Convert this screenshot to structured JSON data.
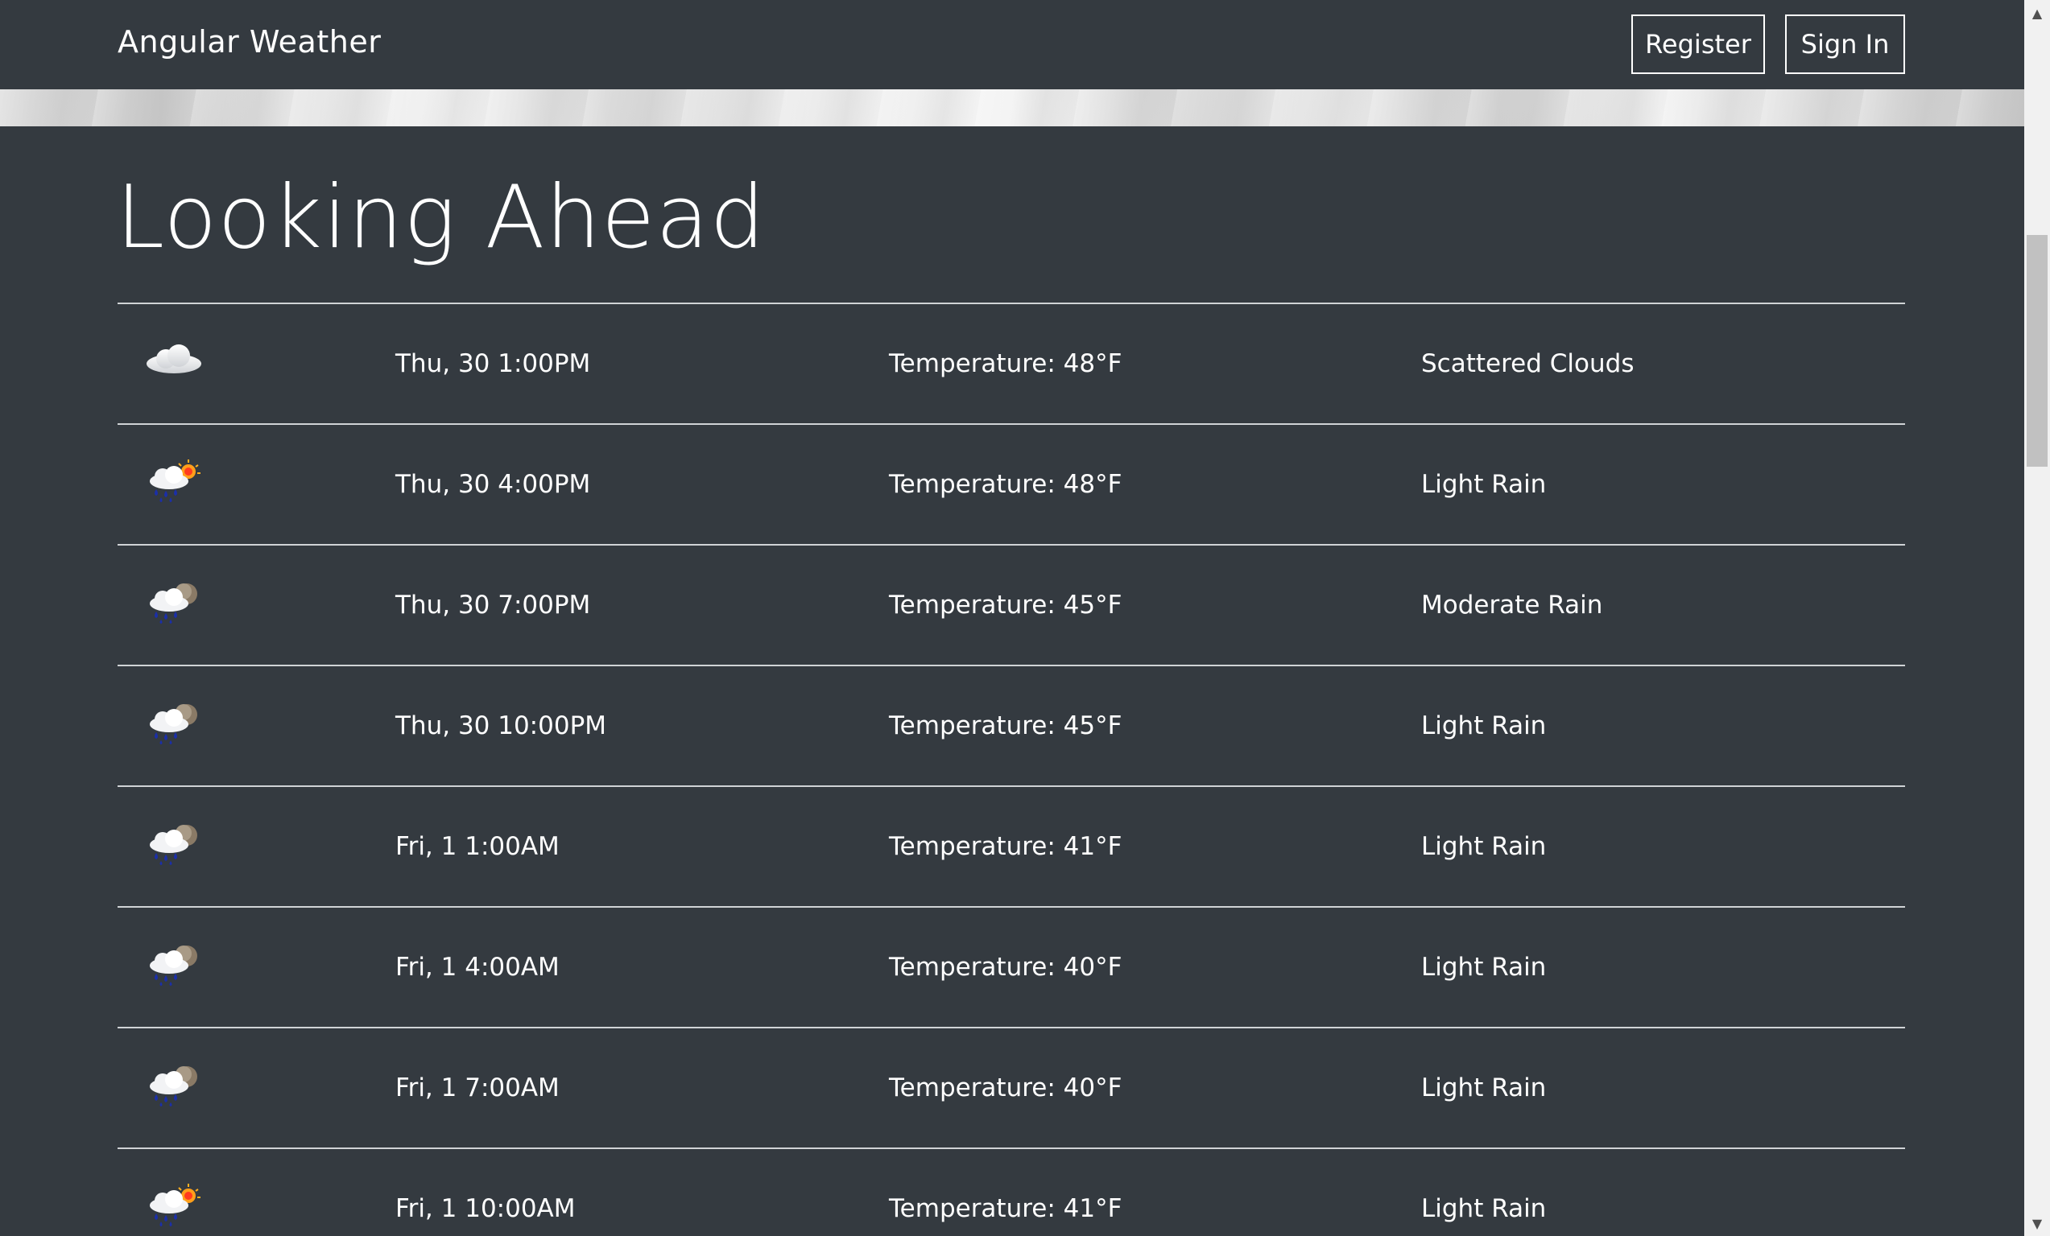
{
  "navbar": {
    "brand": "Angular Weather",
    "register_label": "Register",
    "signin_label": "Sign In"
  },
  "main": {
    "heading": "Looking Ahead",
    "forecast": [
      {
        "icon": "scattered-clouds-icon",
        "time": "Thu, 30 1:00PM",
        "temperature": "Temperature: 48°F",
        "description": "Scattered Clouds"
      },
      {
        "icon": "rain-sun-icon",
        "time": "Thu, 30 4:00PM",
        "temperature": "Temperature: 48°F",
        "description": "Light Rain"
      },
      {
        "icon": "rain-moon-icon",
        "time": "Thu, 30 7:00PM",
        "temperature": "Temperature: 45°F",
        "description": "Moderate Rain"
      },
      {
        "icon": "rain-moon-icon",
        "time": "Thu, 30 10:00PM",
        "temperature": "Temperature: 45°F",
        "description": "Light Rain"
      },
      {
        "icon": "rain-moon-icon",
        "time": "Fri, 1 1:00AM",
        "temperature": "Temperature: 41°F",
        "description": "Light Rain"
      },
      {
        "icon": "rain-moon-icon",
        "time": "Fri, 1 4:00AM",
        "temperature": "Temperature: 40°F",
        "description": "Light Rain"
      },
      {
        "icon": "rain-moon-icon",
        "time": "Fri, 1 7:00AM",
        "temperature": "Temperature: 40°F",
        "description": "Light Rain"
      },
      {
        "icon": "rain-sun-icon",
        "time": "Fri, 1 10:00AM",
        "temperature": "Temperature: 41°F",
        "description": "Light Rain"
      }
    ]
  },
  "colors": {
    "background": "#343a40",
    "text": "#ffffff",
    "divider": "#d0d3d6"
  }
}
